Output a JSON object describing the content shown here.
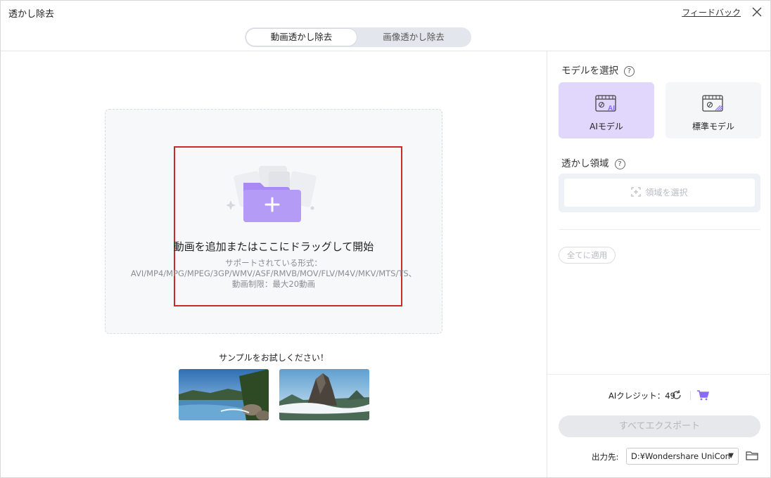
{
  "window": {
    "title": "透かし除去",
    "feedback_label": "フィードバック"
  },
  "tabs": [
    {
      "label": "動画透かし除去",
      "active": true
    },
    {
      "label": "画像透かし除去",
      "active": false
    }
  ],
  "dropzone": {
    "title": "動画を追加またはここにドラッグして開始",
    "formats_label": "サポートされている形式：",
    "formats": "AVI/MP4/MPG/MPEG/3GP/WMV/ASF/RMVB/MOV/FLV/M4V/MKV/MTS/TS、",
    "limit": "動画制限：最大20動画"
  },
  "samples": {
    "title": "サンプルをお試しください！"
  },
  "model": {
    "label": "モデルを選択",
    "options": [
      {
        "label": "AIモデル",
        "selected": true
      },
      {
        "label": "標準モデル",
        "selected": false
      }
    ]
  },
  "region": {
    "label": "透かし領域",
    "select_label": "領域を選択"
  },
  "apply_all_label": "全てに適用",
  "credits": {
    "label": "AIクレジット：",
    "value": "49"
  },
  "export_all_label": "すべてエクスポート",
  "output": {
    "label": "出力先:",
    "path": "D:¥Wondershare UniCon"
  },
  "colors": {
    "accent": "#8b6cf0",
    "selected_card": "#e1d6fb",
    "highlight_border": "#cc2a2a"
  }
}
